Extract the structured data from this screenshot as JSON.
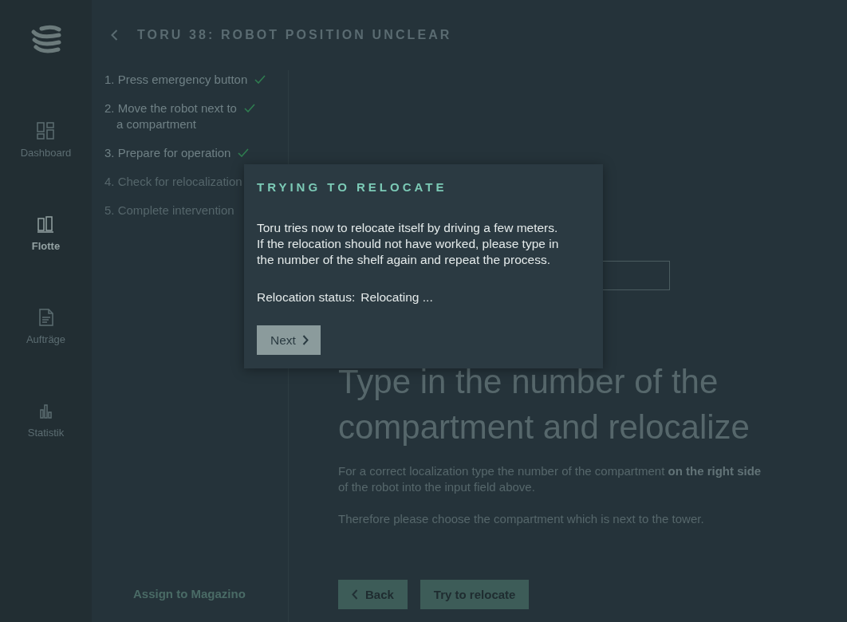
{
  "sidebar": {
    "items": [
      {
        "label": "Dashboard",
        "selected": false
      },
      {
        "label": "Flotte",
        "selected": true
      },
      {
        "label": "Aufträge",
        "selected": false
      },
      {
        "label": "Statistik",
        "selected": false
      }
    ]
  },
  "header": {
    "title": "TORU 38: ROBOT POSITION UNCLEAR"
  },
  "steps": [
    {
      "label": "1. Press emergency button",
      "done": true
    },
    {
      "label": "2. Move the robot next to\na compartment",
      "done": true
    },
    {
      "label": "3. Prepare for operation",
      "done": true
    },
    {
      "label": "4. Check for relocalization",
      "done": false
    },
    {
      "label": "5. Complete intervention",
      "done": false
    }
  ],
  "assign_link": "Assign to Magazino",
  "main": {
    "heading": "Type in the number of the compartment and relocalize",
    "paragraphs": [
      "For a correct localization type the number of the compartment **on the right side** of the robot into the input field above.",
      "Therefore please choose the compartment which is next to the tower."
    ],
    "buttons": [
      {
        "label": "Back",
        "kind": "back"
      },
      {
        "label": "Try to relocate",
        "kind": "primary"
      }
    ]
  },
  "dialog": {
    "title": "TRYING TO RELOCATE",
    "body": "Toru tries now to relocate itself by driving a few meters.\nIf the relocation should not have worked, please type in the number of the shelf again and repeat the process.",
    "status_label": "Relocation status:",
    "status_value": "Relocating ...",
    "button": "Next"
  }
}
